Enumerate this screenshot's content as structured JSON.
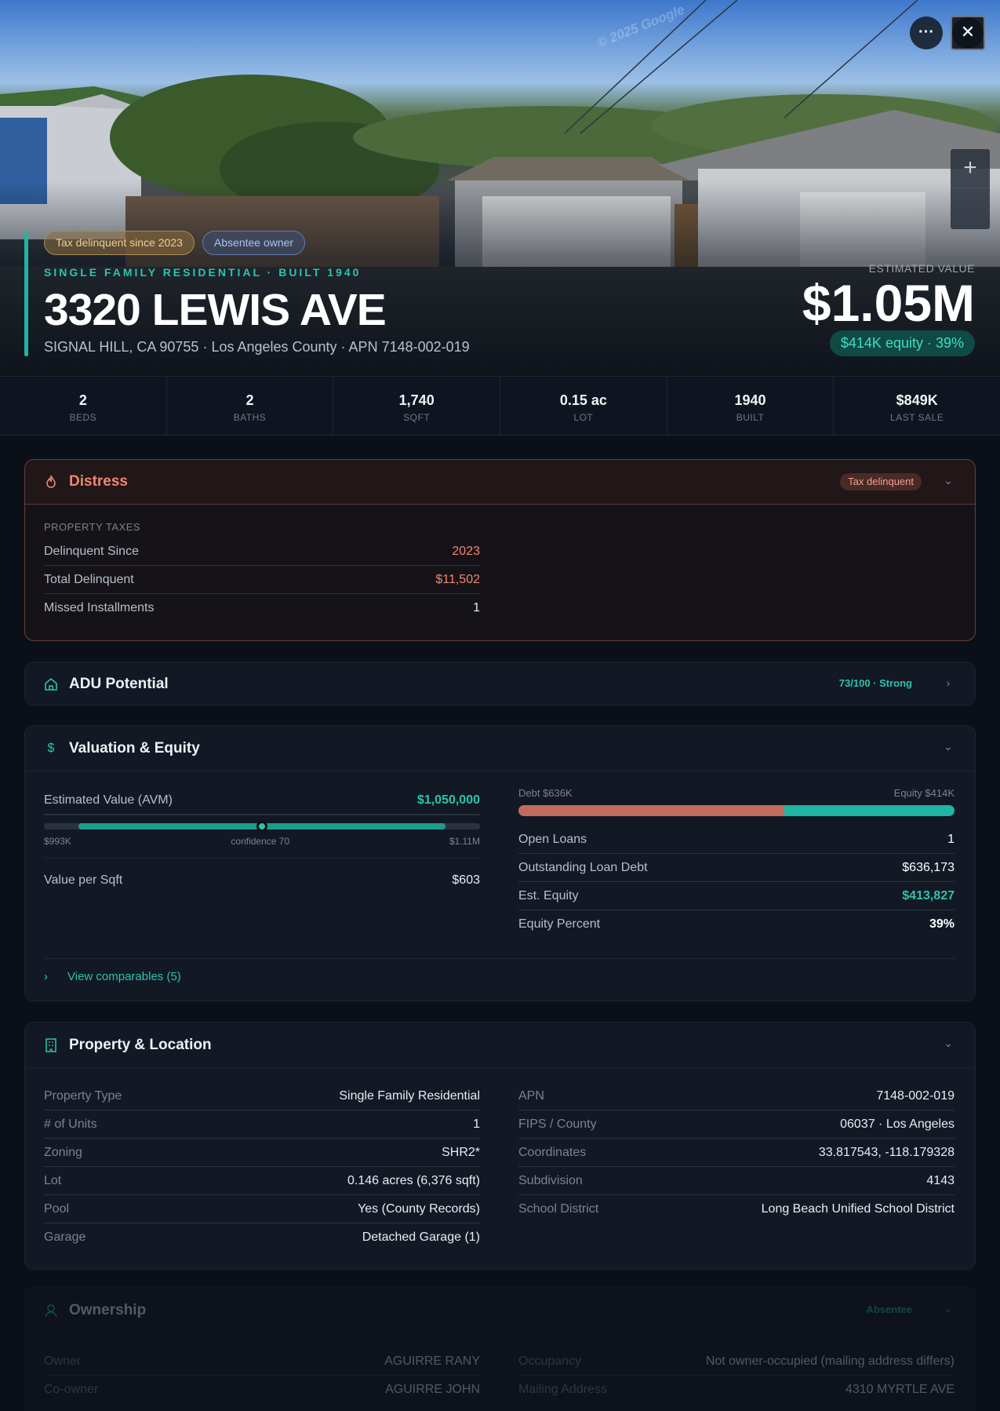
{
  "hero": {
    "watermark": "© 2025 Google",
    "badges": [
      "Tax delinquent since 2023",
      "Absentee owner"
    ],
    "property_type": "SINGLE FAMILY RESIDENTIAL · BUILT 1940",
    "address": "3320 LEWIS AVE",
    "subaddress": "SIGNAL HILL, CA 90755 · Los Angeles County · APN 7148-002-019",
    "est_label": "ESTIMATED VALUE",
    "est_value": "$1.05M",
    "equity_pill": "$414K equity · 39%",
    "more_icon": "···",
    "close_icon": "✕",
    "zoom_in": "+"
  },
  "stats": [
    {
      "value": "2",
      "label": "BEDS"
    },
    {
      "value": "2",
      "label": "BATHS"
    },
    {
      "value": "1,740",
      "label": "SQFT"
    },
    {
      "value": "0.15 ac",
      "label": "LOT"
    },
    {
      "value": "1940",
      "label": "BUILT"
    },
    {
      "value": "$849K",
      "label": "LAST SALE"
    }
  ],
  "distress": {
    "title": "Distress",
    "tag": "Tax delinquent",
    "section": "PROPERTY TAXES",
    "rows": [
      {
        "k": "Delinquent Since",
        "v": "2023"
      },
      {
        "k": "Total Delinquent",
        "v": "$11,502"
      },
      {
        "k": "Missed Installments",
        "v": "1"
      }
    ]
  },
  "adu": {
    "title": "ADU Potential",
    "score": "73/100 · Strong"
  },
  "valuation": {
    "title": "Valuation & Equity",
    "avm_label": "Estimated Value (AVM)",
    "avm_value": "$1,050,000",
    "range_low": "$993K",
    "confidence": "confidence 70",
    "range_high": "$1.11M",
    "range_fill_start": 0.08,
    "range_fill_end": 0.92,
    "range_point": 0.5,
    "vpsf_label": "Value per Sqft",
    "vpsf_value": "$603",
    "debt_label": "Debt $636K",
    "equity_label": "Equity $414K",
    "debt_fraction": 0.61,
    "rows": [
      {
        "k": "Open Loans",
        "v": "1"
      },
      {
        "k": "Outstanding Loan Debt",
        "v": "$636,173"
      },
      {
        "k": "Est. Equity",
        "v": "$413,827"
      },
      {
        "k": "Equity Percent",
        "v": "39%"
      }
    ],
    "comps": "View comparables (5)"
  },
  "property": {
    "title": "Property & Location",
    "left": [
      {
        "k": "Property Type",
        "v": "Single Family Residential"
      },
      {
        "k": "# of Units",
        "v": "1"
      },
      {
        "k": "Zoning",
        "v": "SHR2*"
      },
      {
        "k": "Lot",
        "v": "0.146 acres (6,376 sqft)"
      },
      {
        "k": "Pool",
        "v": "Yes (County Records)"
      },
      {
        "k": "Garage",
        "v": "Detached Garage (1)"
      }
    ],
    "right": [
      {
        "k": "APN",
        "v": "7148-002-019"
      },
      {
        "k": "FIPS / County",
        "v": "06037 · Los Angeles"
      },
      {
        "k": "Coordinates",
        "v": "33.817543, -118.179328"
      },
      {
        "k": "Subdivision",
        "v": "4143"
      },
      {
        "k": "School District",
        "v": "Long Beach Unified School District"
      }
    ]
  },
  "ownership": {
    "title": "Ownership",
    "tag": "Absentee",
    "left": [
      {
        "k": "Owner",
        "v": "AGUIRRE RANY"
      },
      {
        "k": "Co-owner",
        "v": "AGUIRRE JOHN"
      }
    ],
    "right": [
      {
        "k": "Occupancy",
        "v": "Not owner-occupied (mailing address differs)"
      },
      {
        "k": "Mailing Address",
        "v": "4310 MYRTLE AVE"
      }
    ]
  },
  "colors": {
    "accent": "#2cc4ad",
    "danger": "#f08672",
    "debt": "#c16b5e",
    "bg": "#0b1018"
  }
}
